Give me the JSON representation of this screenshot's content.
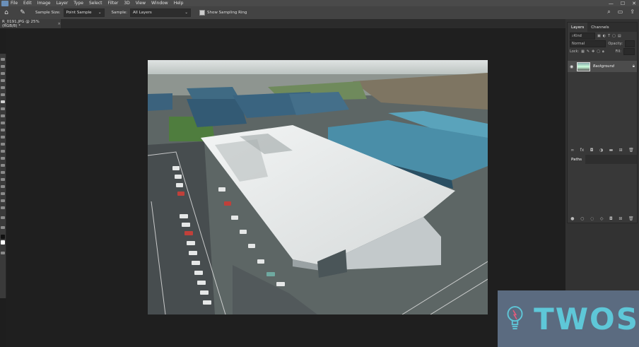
{
  "menu": [
    "File",
    "Edit",
    "Image",
    "Layer",
    "Type",
    "Select",
    "Filter",
    "3D",
    "View",
    "Window",
    "Help"
  ],
  "options": {
    "sample_size_label": "Sample Size:",
    "sample_size_value": "Point Sample",
    "sample_label": "Sample:",
    "sample_value": "All Layers",
    "show_ring_label": "Show Sampling Ring"
  },
  "document": {
    "tab_title": "R_0191.JPG @ 25% (RGB/8) *",
    "close": "×"
  },
  "layers_panel": {
    "tab_layers": "Layers",
    "tab_channels": "Channels",
    "kind_placeholder": "Kind",
    "blend_mode": "Normal",
    "opacity_label": "Opacity:",
    "lock_label": "Lock:",
    "fill_label": "Fill:",
    "layer_name": "Background"
  },
  "paths_panel": {
    "tab_paths": "Paths"
  },
  "watermark": {
    "text": "TWOS"
  },
  "colors": {
    "menubar": "#4a4a4a",
    "optionsbar": "#434343",
    "canvas_bg": "#1f1f1f",
    "panel_bg": "#383838",
    "watermark_bg": "#5b6b80",
    "watermark_text": "#5ec7d8"
  }
}
